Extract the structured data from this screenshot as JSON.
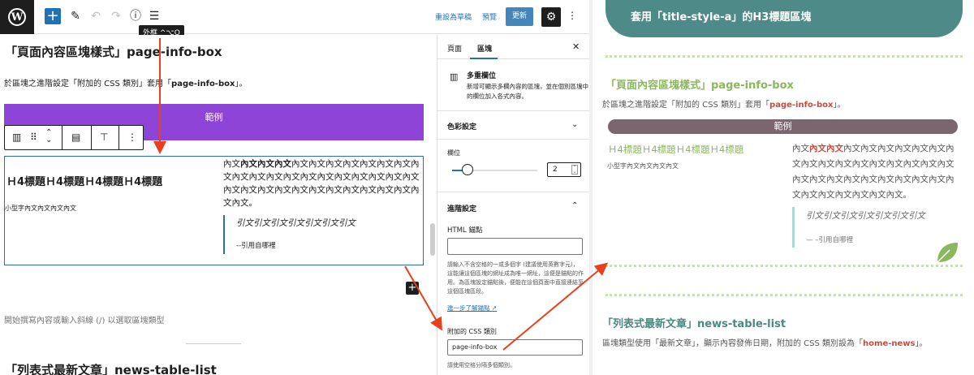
{
  "editor": {
    "toolbar": {
      "tooltip": "外框 ^⌥O",
      "save_draft": "重設為草稿",
      "preview": "預覽",
      "update": "更新"
    },
    "canvas": {
      "heading": "「頁面內容區塊樣式」page-info-box",
      "desc_prefix": "於區塊之進階設定「附加的 CSS 類別」套用「",
      "desc_class": "page-info-box",
      "desc_suffix": "」。",
      "purple_label": "範例",
      "h4": "Ｈ4標題Ｈ4標題Ｈ4標題Ｈ4標題",
      "small": "小型字內文內文內文內文",
      "body_bold": "內文內文內文",
      "body_pre": "內文",
      "body_rest": "內文內文內文內文內文內文內文內文內文內文內文內文內文內文內文內文內文內文內文內文內文內文內文內文內文內文內文內文內文內文內文內文。",
      "quote": "引文引文引文引文引文引文引文",
      "cite": "--引用自哪裡",
      "placeholder": "開始撰寫內容或輸入斜線 (/) 以選取區塊類型",
      "heading2": "「列表式最新文章」news-table-list"
    },
    "sidebar": {
      "tab_page": "頁面",
      "tab_block": "區塊",
      "block_name": "多重欄位",
      "block_desc": "新增可顯示多欄內容的區塊，並在個別區塊中的欄位加入各式內容。",
      "color_settings": "色彩設定",
      "columns_label": "欄位",
      "columns_value": "2",
      "advanced": "進階設定",
      "html_anchor": "HTML 錨點",
      "anchor_help": "請輸入不含空格的一或多個字 (建議使用英數字元)，這能讓這個區塊的網址成為唯一網址，這便是錨點的作用。為區塊設定錨點後，便能在這個頁面中直接連結至這個區塊區段。",
      "learn_more": "進一步了解錨點",
      "css_label": "附加的 CSS 類別",
      "css_value": "page-info-box",
      "css_help": "請使用空格分隔多個類別。"
    }
  },
  "frontend": {
    "banner": "套用「title-style-a」的H3標題區塊",
    "heading": "「頁面內容區塊樣式」page-info-box",
    "desc_prefix": "於區塊之進階設定「附加的 CSS 類別」套用「",
    "desc_class": "page-info-box",
    "desc_suffix": "」。",
    "pill": "範例",
    "h4": "Ｈ4標題Ｈ4標題Ｈ4標題Ｈ4標題",
    "small": "小型字內文內文內文內文",
    "body_pre": "內文",
    "body_red": "內文內文",
    "body_rest": "內文內文內文內文內文內文內文內文內文內文內文內文內文內文內文內文內文內文內文內文內文內文內文內文內文內文內文內文內文內文內文內文。",
    "quote": "引文引文引文引文引文引文引文",
    "cite": "— –引用自哪裡",
    "heading2": "「列表式最新文章」news-table-list",
    "desc2_prefix": "區塊類型使用「最新文章」，顯示內容發佈日期，附加的 CSS 類別設為「",
    "desc2_class": "home-news",
    "desc2_suffix": "」。"
  },
  "colors": {
    "wp_blue": "#2271b1",
    "purple_block": "#8e44d6",
    "banner_teal": "#4d8a88",
    "green_heading": "#8ab85e",
    "pill_mauve": "#7b6670",
    "accent_red": "#c94a3b",
    "arrow_red": "#e8401c"
  }
}
